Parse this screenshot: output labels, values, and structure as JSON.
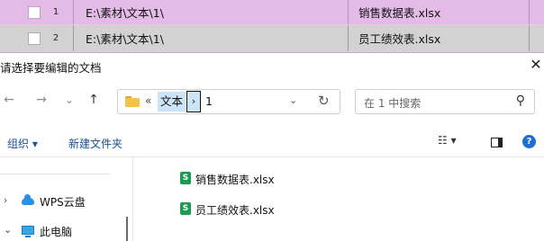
{
  "background_table": {
    "rows": [
      {
        "num": "1",
        "path": "E:\\素材\\文本\\1\\",
        "file": "销售数据表.xlsx"
      },
      {
        "num": "2",
        "path": "E:\\素材\\文本\\1\\",
        "file": "员工绩效表.xlsx"
      }
    ]
  },
  "dialog": {
    "title": "请选择要编辑的文档",
    "close_glyph": "✕",
    "nav": {
      "back": "←",
      "forward": "→",
      "recent": "⌄",
      "up": "↑"
    },
    "address": {
      "overflow": "«",
      "crumb1": "文本",
      "separator": "›",
      "crumb2": "1",
      "dropdown": "⌄",
      "refresh": "↻"
    },
    "search": {
      "placeholder": "在 1 中搜索",
      "icon_glyph": "⚲"
    },
    "toolbar": {
      "organize": "组织 ▾",
      "new_folder": "新建文件夹",
      "view": "☷ ▾",
      "help": "?"
    },
    "nav_pane": {
      "items": [
        {
          "arrow": "›",
          "label": "WPS云盘"
        },
        {
          "arrow": "⌄",
          "label": "此电脑"
        }
      ]
    },
    "files": [
      {
        "icon": "S",
        "name": "销售数据表.xlsx"
      },
      {
        "icon": "S",
        "name": "员工绩效表.xlsx"
      }
    ]
  }
}
